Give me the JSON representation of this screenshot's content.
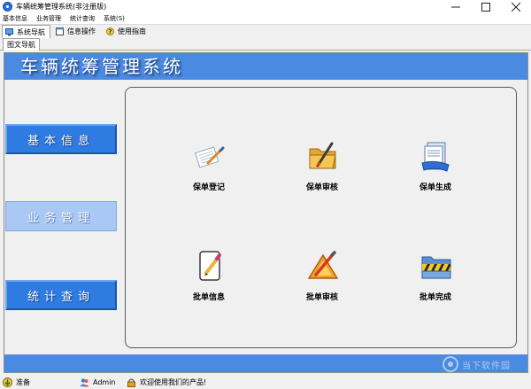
{
  "window": {
    "title": "车辆统筹管理系统(非注册版)"
  },
  "menu": [
    "基本信息",
    "业务管理",
    "统计查询",
    "系统(S)"
  ],
  "toolbar": [
    {
      "label": "系统导航",
      "icon": "monitor-icon"
    },
    {
      "label": "信息操作",
      "icon": "window-icon"
    },
    {
      "label": "使用指南",
      "icon": "help-icon"
    }
  ],
  "view_tab": "图文导航",
  "banner": {
    "title": "车辆统筹管理系统"
  },
  "nav": [
    {
      "label": "基本信息",
      "active": false
    },
    {
      "label": "业务管理",
      "active": true
    },
    {
      "label": "统计查询",
      "active": false
    }
  ],
  "tiles": [
    {
      "label": "保单登记",
      "icon": "pen-paper-icon"
    },
    {
      "label": "保单审核",
      "icon": "folder-pen-icon"
    },
    {
      "label": "保单生成",
      "icon": "document-blue-icon"
    },
    {
      "label": "批单信息",
      "icon": "notepad-pencil-icon"
    },
    {
      "label": "批单审核",
      "icon": "triangle-pen-icon"
    },
    {
      "label": "批单完成",
      "icon": "folder-stripes-icon"
    }
  ],
  "watermark": "当下软件园",
  "status": [
    {
      "label": "准备",
      "icon": "arrow-down-icon"
    },
    {
      "label": "Admin",
      "icon": "users-icon"
    },
    {
      "label": "欢迎使用我们的产品!",
      "icon": "lock-icon"
    }
  ],
  "colors": {
    "banner": "#4a8ae0",
    "nav_button": "#2e7be2",
    "nav_button_active": "#a9c8f4"
  }
}
